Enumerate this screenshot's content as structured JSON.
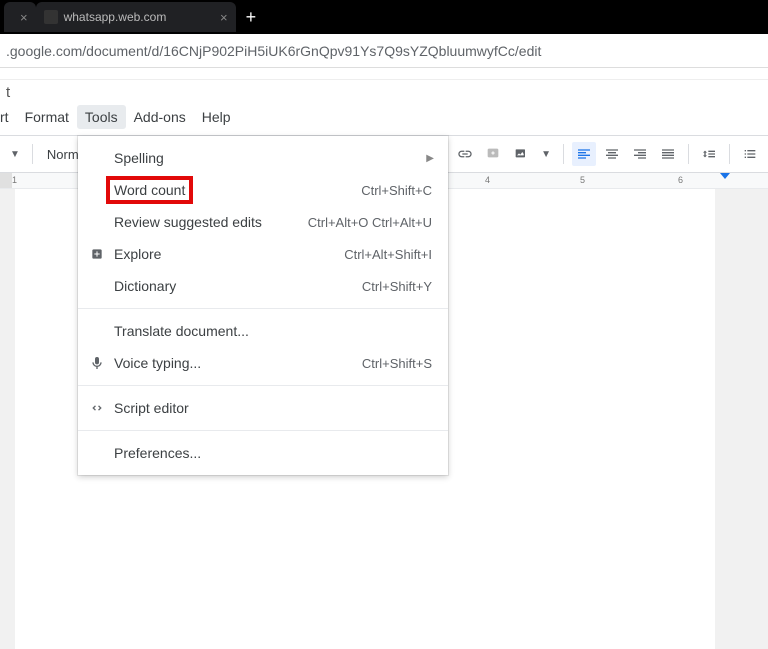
{
  "browser": {
    "tabs": [
      {
        "label": "",
        "close": "×"
      },
      {
        "label": "whatsapp.web.com",
        "close": "×"
      }
    ],
    "new_tab": "+",
    "url": ".google.com/document/d/16CNjP902PiH5iUK6rGnQpv91Ys7Q9sYZQbluumwyfCc/edit"
  },
  "docs": {
    "title_frag": "t",
    "menu": {
      "insert": "rt",
      "format": "Format",
      "tools": "Tools",
      "addons": "Add-ons",
      "help": "Help"
    },
    "toolbar": {
      "style": "Normal"
    },
    "ruler": {
      "ticks": [
        "1",
        "4",
        "5",
        "6"
      ]
    }
  },
  "dropdown": {
    "spelling": {
      "label": "Spelling",
      "shortcut": ""
    },
    "wordcount": {
      "label": "Word count",
      "shortcut": "Ctrl+Shift+C"
    },
    "review": {
      "label": "Review suggested edits",
      "shortcut": "Ctrl+Alt+O Ctrl+Alt+U"
    },
    "explore": {
      "label": "Explore",
      "shortcut": "Ctrl+Alt+Shift+I"
    },
    "dictionary": {
      "label": "Dictionary",
      "shortcut": "Ctrl+Shift+Y"
    },
    "translate": {
      "label": "Translate document..."
    },
    "voice": {
      "label": "Voice typing...",
      "shortcut": "Ctrl+Shift+S"
    },
    "script": {
      "label": "Script editor"
    },
    "prefs": {
      "label": "Preferences..."
    }
  }
}
